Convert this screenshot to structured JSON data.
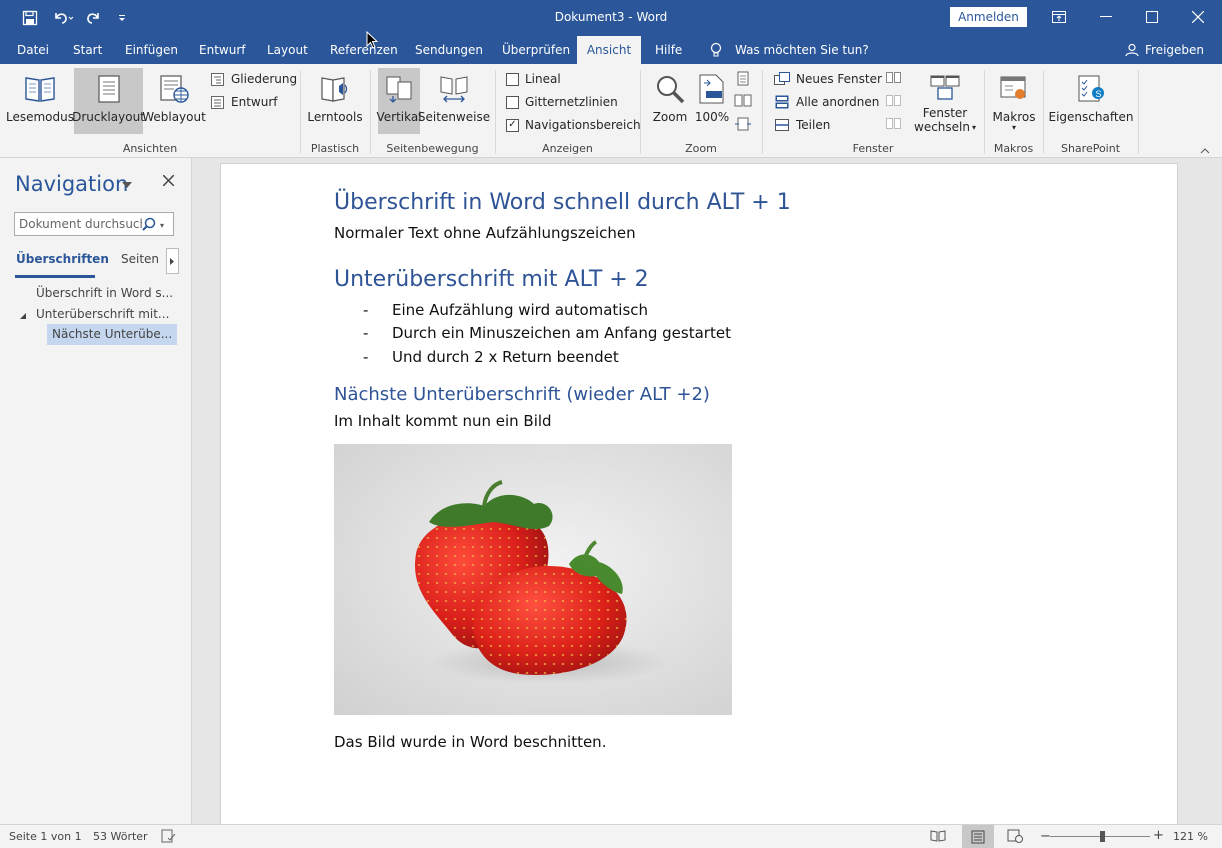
{
  "titlebar": {
    "title": "Dokument3  -  Word",
    "signin": "Anmelden"
  },
  "tabs": [
    "Datei",
    "Start",
    "Einfügen",
    "Entwurf",
    "Layout",
    "Referenzen",
    "Sendungen",
    "Überprüfen",
    "Ansicht",
    "Hilfe"
  ],
  "tellme": "Was möchten Sie tun?",
  "share": "Freigeben",
  "ribbon": {
    "ansichten": {
      "label": "Ansichten",
      "lesemodus": "Lesemodus",
      "drucklayout": "Drucklayout",
      "weblayout": "Weblayout",
      "gliederung": "Gliederung",
      "entwurf": "Entwurf"
    },
    "plastisch": {
      "label": "Plastisch",
      "lerntools": "Lerntools"
    },
    "seitenbewegung": {
      "label": "Seitenbewegung",
      "vertikal": "Vertikal",
      "seitenweise": "Seitenweise"
    },
    "anzeigen": {
      "label": "Anzeigen",
      "lineal": "Lineal",
      "gitternetzlinien": "Gitternetzlinien",
      "navigationsbereich": "Navigationsbereich"
    },
    "zoom": {
      "label": "Zoom",
      "zoom": "Zoom",
      "hundert": "100%"
    },
    "fenster": {
      "label": "Fenster",
      "neues_fenster": "Neues Fenster",
      "alle_anordnen": "Alle anordnen",
      "teilen": "Teilen",
      "wechseln1": "Fenster",
      "wechseln2": "wechseln"
    },
    "makros": {
      "label": "Makros",
      "makros": "Makros"
    },
    "sharepoint": {
      "label": "SharePoint",
      "eigenschaften": "Eigenschaften"
    }
  },
  "nav": {
    "title": "Navigation",
    "search_placeholder": "Dokument durchsuchen",
    "tab_headings": "Überschriften",
    "tab_pages": "Seiten",
    "items": [
      "Überschrift in Word s...",
      "Unterüberschrift mit...",
      "Nächste Unterübe..."
    ]
  },
  "document": {
    "h1": "Überschrift in Word schnell durch ALT + 1",
    "p1": "Normaler Text ohne Aufzählungszeichen",
    "h2a": "Unterüberschrift mit ALT + 2",
    "bullets": [
      "Eine Aufzählung wird automatisch",
      "Durch ein Minuszeichen am Anfang gestartet",
      "Und durch 2 x Return beendet"
    ],
    "bullet_marker": "-",
    "h2b": "Nächste Unterüberschrift (wieder ALT +2)",
    "p2": "Im Inhalt kommt nun ein Bild",
    "caption": "Das Bild wurde in Word beschnitten."
  },
  "status": {
    "page": "Seite 1 von 1",
    "words": "53 Wörter",
    "zoom": "121 %"
  },
  "colors": {
    "accent": "#2b579a",
    "heading": "#2f5496"
  }
}
